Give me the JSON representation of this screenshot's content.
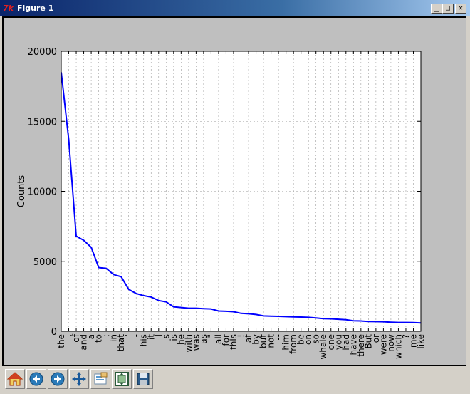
{
  "window": {
    "title": "Figure 1",
    "app_icon": "tk-feather-icon"
  },
  "title_buttons": [
    {
      "name": "minimize-button",
      "glyph": "_"
    },
    {
      "name": "maximize-button",
      "glyph": "□"
    },
    {
      "name": "close-button",
      "glyph": "✕"
    }
  ],
  "toolbar": {
    "buttons": [
      {
        "name": "home-button",
        "icon": "home-icon"
      },
      {
        "name": "back-button",
        "icon": "arrow-left-icon"
      },
      {
        "name": "forward-button",
        "icon": "arrow-right-icon"
      },
      {
        "name": "pan-button",
        "icon": "move-icon"
      },
      {
        "name": "zoom-button",
        "icon": "zoom-rect-icon"
      },
      {
        "name": "subplots-button",
        "icon": "subplots-icon"
      },
      {
        "name": "save-button",
        "icon": "floppy-disk-icon"
      }
    ]
  },
  "colors": {
    "line": "#0000ff",
    "figure_bg": "#bfbfbf",
    "axes_bg": "#ffffff"
  },
  "chart_data": {
    "type": "line",
    "title": "",
    "xlabel": "",
    "ylabel": "Counts",
    "ylim": [
      0,
      20000
    ],
    "yticks": [
      0,
      5000,
      10000,
      15000,
      20000
    ],
    "grid": true,
    "categories": [
      "the",
      ",",
      "of",
      "and",
      "a",
      "to",
      ";",
      "in",
      "that",
      "'",
      "-",
      "his",
      "it",
      "I",
      "s",
      "is",
      "he",
      "with",
      "was",
      "as",
      "\"",
      "all",
      "for",
      "this",
      "!",
      "at",
      "by",
      "but",
      "not",
      "--",
      "him",
      "from",
      "be",
      "on",
      "so",
      "whale",
      "one",
      "you",
      "had",
      "have",
      "there",
      "But",
      "or",
      "were",
      "now",
      "which",
      "?",
      "me",
      "like"
    ],
    "series": [
      {
        "values": [
          18500,
          13700,
          6800,
          6500,
          6000,
          4550,
          4500,
          4050,
          3900,
          3000,
          2700,
          2550,
          2450,
          2200,
          2100,
          1750,
          1700,
          1650,
          1650,
          1620,
          1600,
          1450,
          1430,
          1400,
          1280,
          1250,
          1200,
          1100,
          1080,
          1070,
          1050,
          1030,
          1020,
          1000,
          950,
          900,
          890,
          860,
          830,
          750,
          740,
          700,
          690,
          680,
          650,
          630,
          630,
          620,
          600
        ]
      }
    ]
  }
}
